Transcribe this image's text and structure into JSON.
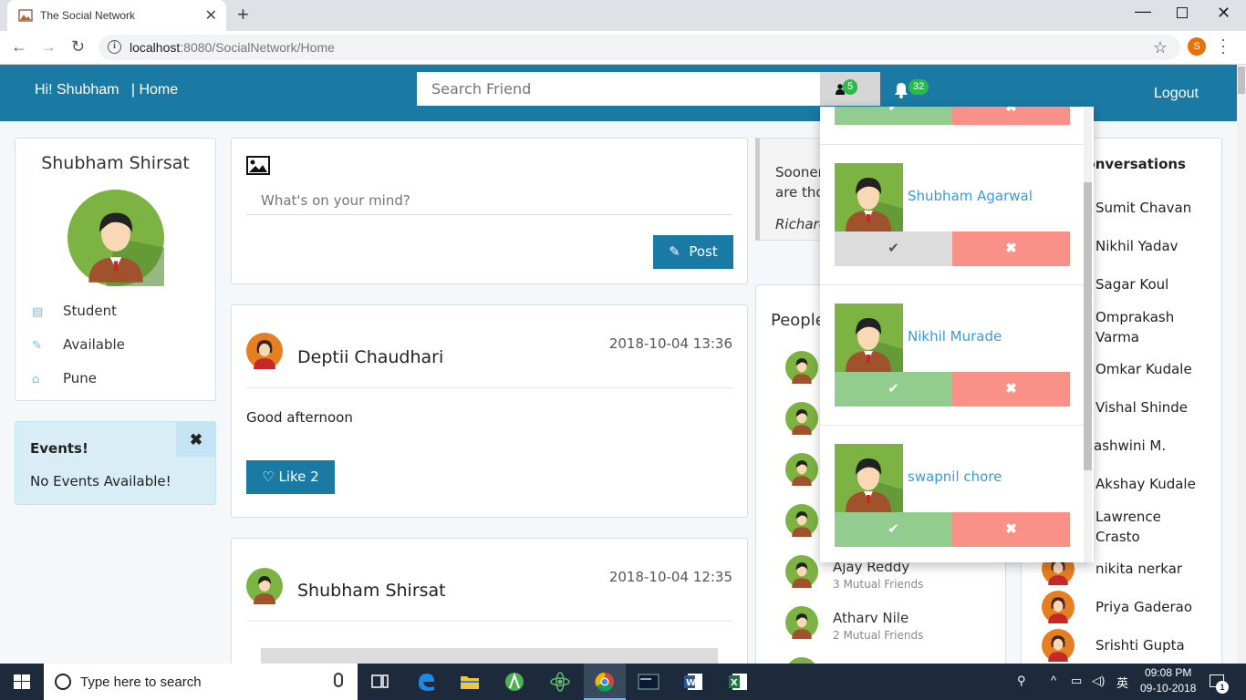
{
  "browser": {
    "tab_title": "The Social Network",
    "url_host": "localhost",
    "url_rest": ":8080/SocialNetwork/Home",
    "profile_initial": "S"
  },
  "header": {
    "greeting": "Hi! Shubham",
    "home_link": "| Home",
    "search_placeholder": "Search Friend",
    "friend_request_count": "5",
    "notification_count": "32",
    "logout_label": "Logout",
    "color": "#1a7aa3"
  },
  "profile": {
    "name": "Shubham Shirsat",
    "occupation": "Student",
    "status": "Available",
    "city": "Pune"
  },
  "events": {
    "title": "Events!",
    "message": "No Events Available!",
    "close_glyph": "✖"
  },
  "compose": {
    "placeholder": "What's on your mind?",
    "post_label": "Post"
  },
  "posts": [
    {
      "author": "Deptii Chaudhari",
      "time": "2018-10-04 13:36",
      "text": "Good afternoon",
      "like_label": "Like 2"
    },
    {
      "author": "Shubham Shirsat",
      "time": "2018-10-04 12:35"
    }
  ],
  "quote": {
    "text_line1": "Sooner",
    "text_line2": "are tho",
    "author": "Richard"
  },
  "people": {
    "title": "People",
    "items": [
      {
        "name": "Ajay Reddy",
        "mutual": "3 Mutual Friends"
      },
      {
        "name": "Atharv Nile",
        "mutual": "2 Mutual Friends"
      }
    ]
  },
  "conversations": {
    "title": "Conversations",
    "items": [
      "Sumit Chavan",
      "Nikhil Yadav",
      "Sagar Koul",
      "Omprakash Varma",
      "Omkar Kudale",
      "Vishal Shinde",
      "ashwini M.",
      "Akshay Kudale",
      "Lawrence Crasto",
      "nikita nerkar",
      "Priya Gaderao",
      "Srishti Gupta"
    ]
  },
  "friend_requests": [
    {
      "name": "Shubham Agarwal"
    },
    {
      "name": "Nikhil Murade"
    },
    {
      "name": "swapnil chore"
    }
  ],
  "colors": {
    "accept": "#93cc8f",
    "accept_hover": "#dcdcdc",
    "reject": "#f99189",
    "badge": "#2db84b"
  },
  "taskbar": {
    "search_placeholder": "Type here to search",
    "time": "09:08 PM",
    "date": "09-10-2018",
    "notification_count": "1"
  }
}
